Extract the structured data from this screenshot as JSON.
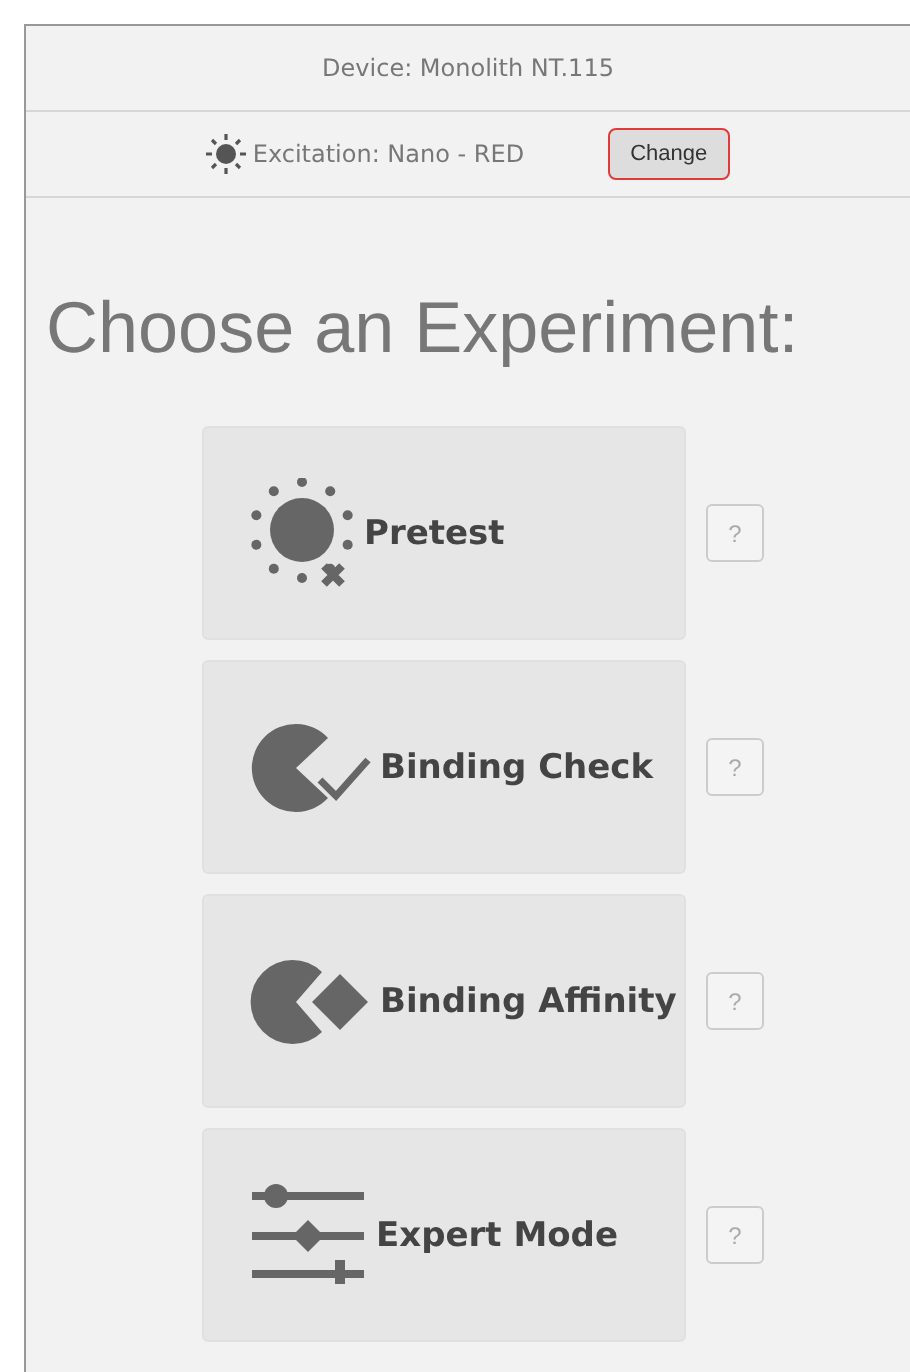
{
  "device": "Device: Monolith NT.115",
  "excitation": {
    "label": "Excitation: Nano - RED",
    "button": "Change",
    "button_focused": true
  },
  "title": "Choose an Experiment:",
  "experiments": [
    {
      "kind": "pretest",
      "label": "Pretest",
      "help": "?"
    },
    {
      "kind": "binding-check",
      "label": "Binding Check",
      "help": "?"
    },
    {
      "kind": "binding-affinity",
      "label": "Binding Affinity",
      "help": "?"
    },
    {
      "kind": "expert",
      "label": "Expert Mode",
      "help": "?"
    }
  ]
}
